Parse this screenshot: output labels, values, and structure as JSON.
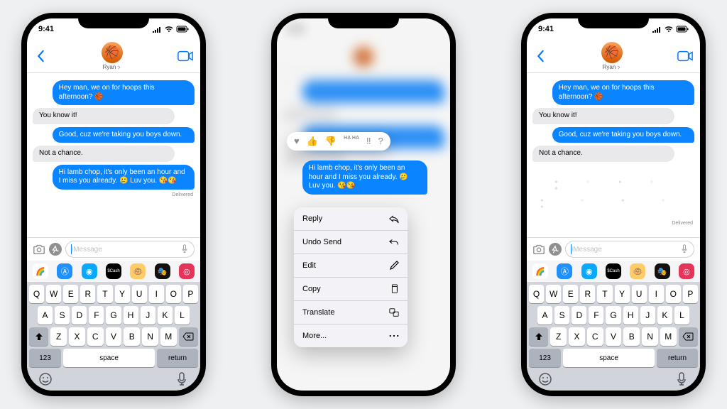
{
  "status": {
    "time": "9:41"
  },
  "chat": {
    "contact": "Ryan",
    "messages": [
      {
        "dir": "sent",
        "text": "Hey man, we on for hoops this afternoon? 🏀"
      },
      {
        "dir": "recv",
        "text": "You know it!"
      },
      {
        "dir": "sent",
        "text": "Good, cuz we're taking you boys down."
      },
      {
        "dir": "recv",
        "text": "Not a chance."
      },
      {
        "dir": "sent",
        "text": "Hi lamb chop, it's only been an hour and I miss you already. 🥲 Luv you. 😘😘"
      }
    ],
    "delivered_label": "Delivered",
    "input_placeholder": "iMessage"
  },
  "tapback": [
    "♥",
    "👍",
    "👎",
    "HA HA",
    "‼︎",
    "?"
  ],
  "context_menu": [
    {
      "label": "Reply",
      "icon": "reply"
    },
    {
      "label": "Undo Send",
      "icon": "undo"
    },
    {
      "label": "Edit",
      "icon": "edit"
    },
    {
      "label": "Copy",
      "icon": "copy"
    },
    {
      "label": "Translate",
      "icon": "translate"
    },
    {
      "label": "More...",
      "icon": "more"
    }
  ],
  "keyboard": {
    "row1": [
      "Q",
      "W",
      "E",
      "R",
      "T",
      "Y",
      "U",
      "I",
      "O",
      "P"
    ],
    "row2": [
      "A",
      "S",
      "D",
      "F",
      "G",
      "H",
      "J",
      "K",
      "L"
    ],
    "row3": [
      "Z",
      "X",
      "C",
      "V",
      "B",
      "N",
      "M"
    ],
    "num": "123",
    "space": "space",
    "return": "return"
  }
}
